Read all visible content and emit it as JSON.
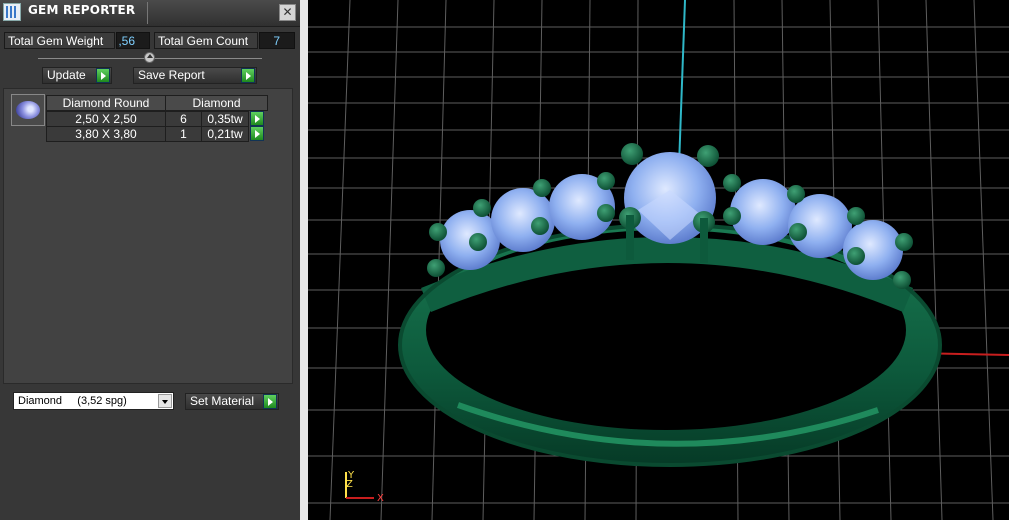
{
  "window": {
    "title": "GEM REPORTER",
    "close": "✕"
  },
  "summary": {
    "total_weight_label": "Total Gem Weight",
    "total_weight_value": ",56",
    "total_count_label": "Total Gem Count",
    "total_count_value": "7"
  },
  "actions": {
    "update": "Update",
    "save_report": "Save Report"
  },
  "table": {
    "headers": [
      "Diamond Round",
      "Diamond"
    ],
    "rows": [
      {
        "size": "2,50 X 2,50",
        "count": "6",
        "weight": "0,35tw"
      },
      {
        "size": "3,80 X 3,80",
        "count": "1",
        "weight": "0,21tw"
      }
    ]
  },
  "material": {
    "selected": "Diamond     (3,52 spg)",
    "set_label": "Set Material"
  },
  "axis": {
    "z": "Z",
    "y": "Y",
    "x": "X"
  },
  "colors": {
    "metal": "#0d5a3c",
    "gem": "#8fb0f0",
    "grid": "#5e5e5e",
    "y_axis": "#2fb8c8",
    "x_axis": "#c81e1e"
  }
}
